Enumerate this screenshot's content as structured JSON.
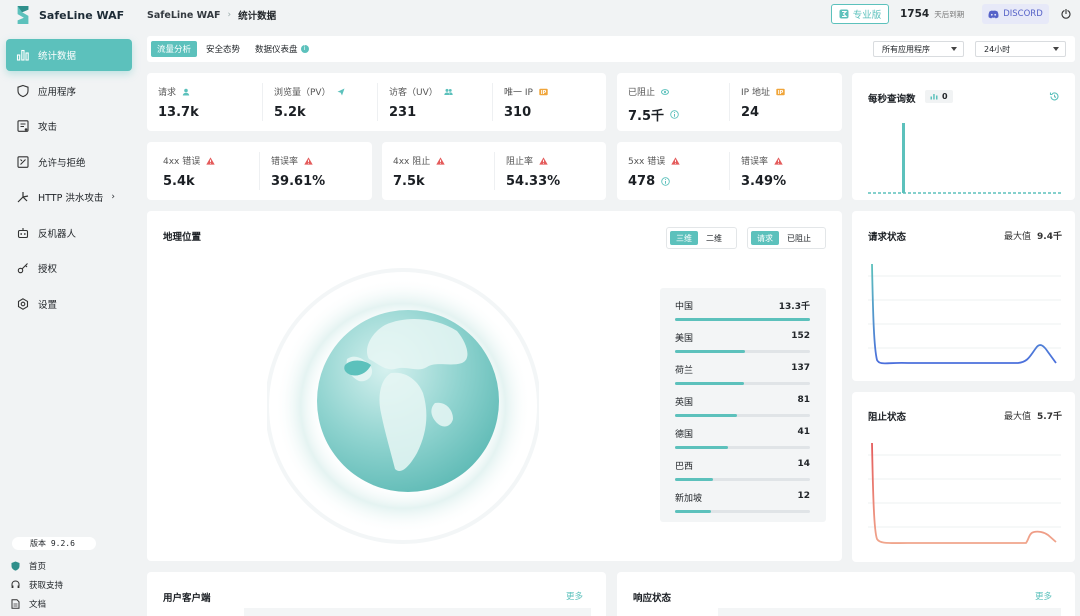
{
  "app": {
    "name": "SafeLine WAF"
  },
  "sidebar": {
    "items": [
      {
        "label": "统计数据",
        "icon": "bar-chart-icon",
        "active": true
      },
      {
        "label": "应用程序",
        "icon": "shield-icon"
      },
      {
        "label": "攻击",
        "icon": "attack-log-icon"
      },
      {
        "label": "允许与拒绝",
        "icon": "allow-deny-icon"
      },
      {
        "label": "HTTP 洪水攻击",
        "icon": "flood-icon",
        "has_submenu": true
      },
      {
        "label": "反机器人",
        "icon": "bot-icon"
      },
      {
        "label": "授权",
        "icon": "key-icon"
      },
      {
        "label": "设置",
        "icon": "gear-icon"
      }
    ],
    "version": "版本 9.2.6",
    "footer_links": [
      {
        "label": "首页",
        "icon": "home-shield-icon"
      },
      {
        "label": "获取支持",
        "icon": "headset-icon"
      },
      {
        "label": "文档",
        "icon": "document-icon"
      }
    ]
  },
  "header": {
    "breadcrumb": [
      "SafeLine WAF",
      "统计数据"
    ],
    "pro_label": "专业版",
    "days_left": "1754",
    "days_suffix": "天后到期",
    "discord_label": "DISCORD"
  },
  "tabs": [
    {
      "label": "流量分析",
      "active": true
    },
    {
      "label": "安全态势"
    },
    {
      "label": "数据仪表盘"
    }
  ],
  "filters": {
    "app_select": "所有应用程序",
    "time_select": "24小时"
  },
  "stats": {
    "requests": {
      "label": "请求",
      "value": "13.7k"
    },
    "pv": {
      "label": "浏览量（PV）",
      "value": "5.2k"
    },
    "uv": {
      "label": "访客（UV）",
      "value": "231"
    },
    "unique_ip": {
      "label": "唯一 IP",
      "value": "310"
    },
    "blocked": {
      "label": "已阻止",
      "value": "7.5千"
    },
    "ip_addr": {
      "label": "IP 地址",
      "value": "24"
    },
    "err4xx": {
      "label": "4xx 错误",
      "value": "5.4k"
    },
    "err4xx_rate": {
      "label": "错误率",
      "value": "39.61%"
    },
    "block4xx": {
      "label": "4xx 阻止",
      "value": "7.5k"
    },
    "block_rate": {
      "label": "阻止率",
      "value": "54.33%"
    },
    "err5xx": {
      "label": "5xx 错误",
      "value": "478"
    },
    "err5xx_rate": {
      "label": "错误率",
      "value": "3.49%"
    }
  },
  "qps": {
    "title": "每秒查询数",
    "value": "0"
  },
  "req_status": {
    "title": "请求状态",
    "max_label": "最大值",
    "max_value": "9.4千"
  },
  "block_status": {
    "title": "阻止状态",
    "max_label": "最大值",
    "max_value": "5.7千"
  },
  "geo": {
    "title": "地理位置",
    "view_toggle": [
      {
        "label": "三维",
        "active": true
      },
      {
        "label": "二维"
      }
    ],
    "type_toggle": [
      {
        "label": "请求",
        "active": true
      },
      {
        "label": "已阻止"
      }
    ],
    "countries": [
      {
        "name": "中国",
        "value": "13.3千",
        "fraction": 1.0
      },
      {
        "name": "美国",
        "value": "152",
        "fraction": 0.52
      },
      {
        "name": "荷兰",
        "value": "137",
        "fraction": 0.51
      },
      {
        "name": "英国",
        "value": "81",
        "fraction": 0.46
      },
      {
        "name": "德国",
        "value": "41",
        "fraction": 0.39
      },
      {
        "name": "巴西",
        "value": "14",
        "fraction": 0.28
      },
      {
        "name": "新加坡",
        "value": "12",
        "fraction": 0.27
      }
    ]
  },
  "bottom": {
    "clients": {
      "title": "用户客户端",
      "more": "更多"
    },
    "response": {
      "title": "响应状态",
      "more": "更多"
    }
  },
  "colors": {
    "accent": "#5cc1bc",
    "request_line": "#4b6fdc",
    "block_line": "#f0a58c",
    "warning": "#e45b5b",
    "ip_badge": "#f0a53a"
  }
}
